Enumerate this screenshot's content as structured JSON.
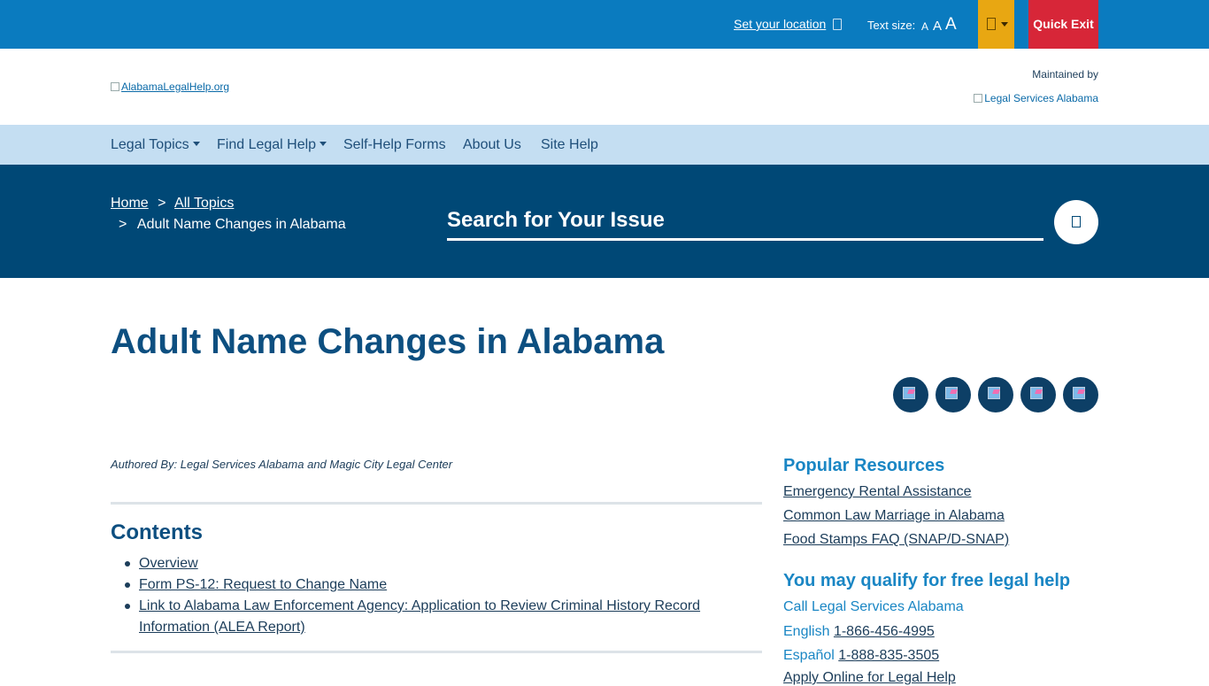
{
  "topbar": {
    "location_link": "Set your location",
    "text_size_label": "Text size:",
    "text_sizes": [
      "A",
      "A",
      "A"
    ],
    "quick_exit": "Quick Exit",
    "colors": {
      "bar": "#0a7bbf",
      "language": "#e8a712",
      "exit": "#d72638"
    }
  },
  "header": {
    "logo_alt": "AlabamaLegalHelp.org",
    "maintained_by": "Maintained by",
    "maintainer_logo_alt": "Legal Services Alabama"
  },
  "nav": {
    "items": [
      {
        "label": "Legal Topics"
      },
      {
        "label": "Find Legal Help"
      },
      {
        "label": "Self-Help Forms"
      },
      {
        "label": "About Us"
      },
      {
        "label": "Site Help"
      }
    ]
  },
  "breadcrumb": {
    "home": "Home",
    "all_topics": "All Topics",
    "sep": ">",
    "current": "Adult Name Changes in Alabama"
  },
  "search": {
    "placeholder": "Search for Your Issue"
  },
  "page": {
    "title": "Adult Name Changes in Alabama",
    "author": "Authored By: Legal Services Alabama and Magic City Legal Center",
    "contents_heading": "Contents",
    "toc": [
      "Overview",
      "Form PS-12: Request to Change Name",
      "Link to Alabama Law Enforcement Agency: Application to Review Criminal History Record Information (ALEA Report)"
    ],
    "share_icons": [
      "facebook-share-icon",
      "twitter-share-icon",
      "linkedin-share-icon",
      "email-share-icon",
      "print-icon"
    ]
  },
  "sidebar": {
    "popular_heading": "Popular Resources",
    "popular": [
      "Emergency Rental Assistance",
      "Common Law Marriage in Alabama",
      "Food Stamps FAQ (SNAP/D-SNAP)"
    ],
    "qualify_heading": "You may qualify for free legal help",
    "call_text": "Call Legal Services Alabama",
    "english_label": "English",
    "english_phone": "1-866-456-4995",
    "spanish_label": "Español",
    "spanish_phone": "1-888-835-3505",
    "apply_online": "Apply Online for Legal Help"
  }
}
